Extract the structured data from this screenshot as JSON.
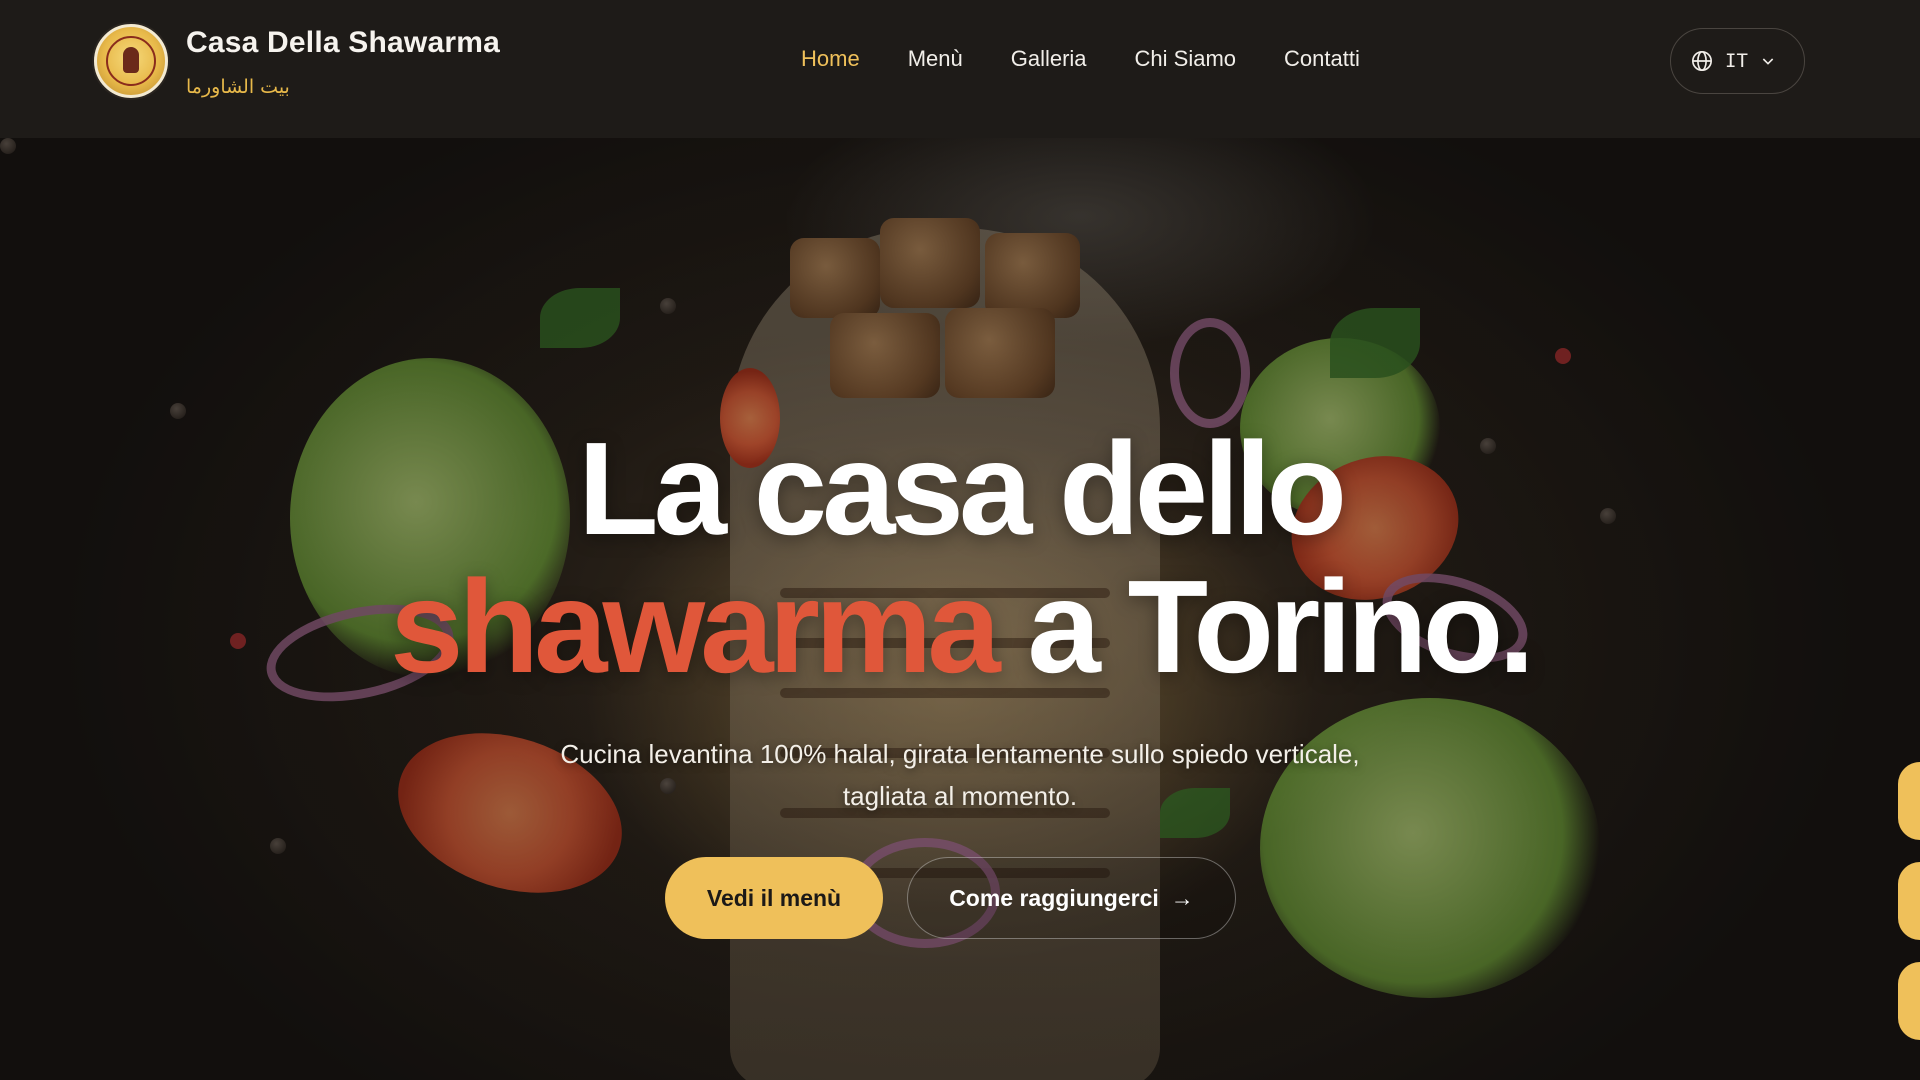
{
  "brand": {
    "name": "Casa Della Shawarma",
    "subtitle": "بيت الشاورما"
  },
  "nav": {
    "items": [
      {
        "label": "Home",
        "active": true
      },
      {
        "label": "Menù",
        "active": false
      },
      {
        "label": "Galleria",
        "active": false
      },
      {
        "label": "Chi Siamo",
        "active": false
      },
      {
        "label": "Contatti",
        "active": false
      }
    ]
  },
  "language": {
    "selected": "IT",
    "icon": "globe-icon",
    "chevron": "chevron-down-icon"
  },
  "hero": {
    "title_line1": "La casa dello",
    "title_accent": "shawarma",
    "title_rest": "a Torino.",
    "subtitle_line1": "Cucina levantina 100% halal, girata lentamente sullo spiedo verticale,",
    "subtitle_line2": "tagliata al momento.",
    "primary_cta": "Vedi il menù",
    "secondary_cta": "Come raggiungerci",
    "secondary_cta_arrow": "→"
  },
  "colors": {
    "accent_gold": "#efc05a",
    "accent_red": "#e0573a",
    "nav_bg": "#1e1b18"
  }
}
